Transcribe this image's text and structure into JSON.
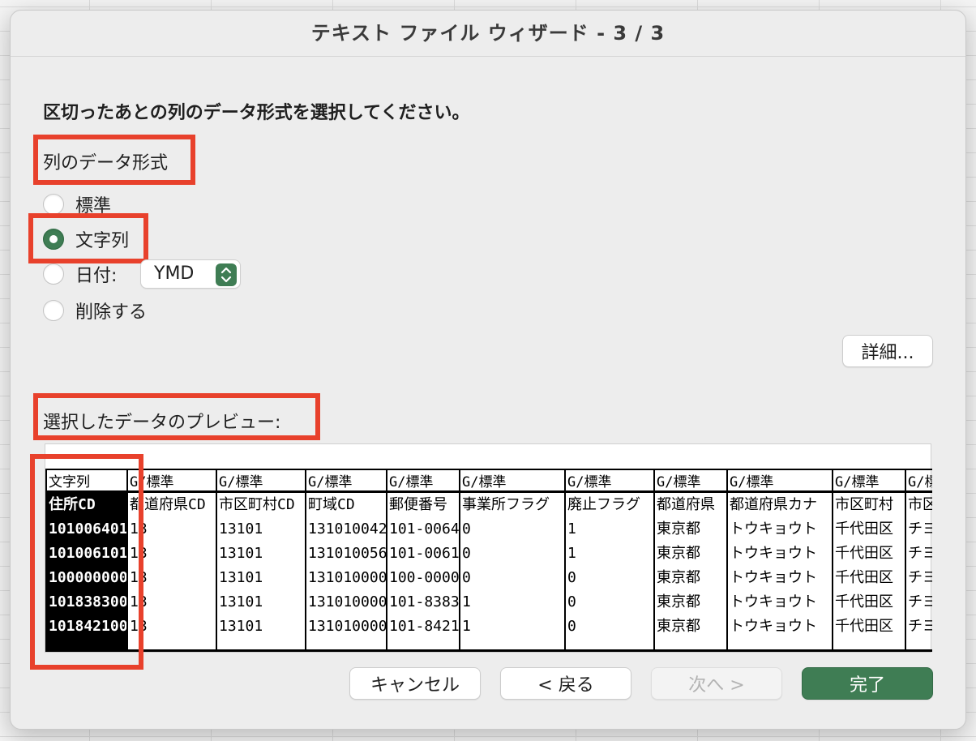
{
  "window": {
    "title": "テキスト ファイル ウィザード - 3 / 3"
  },
  "instruction": "区切ったあとの列のデータ形式を選択してください。",
  "format_section": {
    "label": "列のデータ形式",
    "options": [
      {
        "label": "標準",
        "checked": false
      },
      {
        "label": "文字列",
        "checked": true
      },
      {
        "label": "日付:",
        "checked": false
      },
      {
        "label": "削除する",
        "checked": false
      }
    ],
    "date_format_value": "YMD"
  },
  "details_button": "詳細...",
  "preview": {
    "label": "選択したデータのプレビュー:",
    "columns": [
      {
        "format": "文字列",
        "cells": [
          "住所CD",
          "101006401",
          "101006101",
          "100000000",
          "101838300",
          "101842100"
        ]
      },
      {
        "format": "G/標準",
        "cells": [
          "都道府県CD",
          "13",
          "13",
          "13",
          "13",
          "13"
        ]
      },
      {
        "format": "G/標準",
        "cells": [
          "市区町村CD",
          "13101",
          "13101",
          "13101",
          "13101",
          "13101"
        ]
      },
      {
        "format": "G/標準",
        "cells": [
          "町域CD",
          "131010042",
          "131010056",
          "131010000",
          "131010000",
          "131010000"
        ]
      },
      {
        "format": "G/標準",
        "cells": [
          "郵便番号",
          "101-0064",
          "101-0061",
          "100-0000",
          "101-8383",
          "101-8421"
        ]
      },
      {
        "format": "G/標準",
        "cells": [
          "事業所フラグ",
          "0",
          "0",
          "0",
          "1",
          "1"
        ]
      },
      {
        "format": "G/標準",
        "cells": [
          "廃止フラグ",
          "1",
          "1",
          "0",
          "0",
          "0"
        ]
      },
      {
        "format": "G/標準",
        "cells": [
          "都道府県",
          "東京都",
          "東京都",
          "東京都",
          "東京都",
          "東京都"
        ]
      },
      {
        "format": "G/標準",
        "cells": [
          "都道府県カナ",
          "トウキョウト",
          "トウキョウト",
          "トウキョウト",
          "トウキョウト",
          "トウキョウト"
        ]
      },
      {
        "format": "G/標準",
        "cells": [
          "市区町村",
          "千代田区",
          "千代田区",
          "千代田区",
          "千代田区",
          "千代田区"
        ]
      },
      {
        "format": "G/標",
        "cells": [
          "市区",
          "チヨ",
          "チヨ",
          "チヨ",
          "チヨ",
          "チヨ"
        ]
      }
    ]
  },
  "buttons": {
    "cancel": "キャンセル",
    "back": "< 戻る",
    "next": "次へ >",
    "finish": "完了"
  },
  "colors": {
    "accent": "#3f7d54",
    "highlight_box": "#e8412c"
  }
}
